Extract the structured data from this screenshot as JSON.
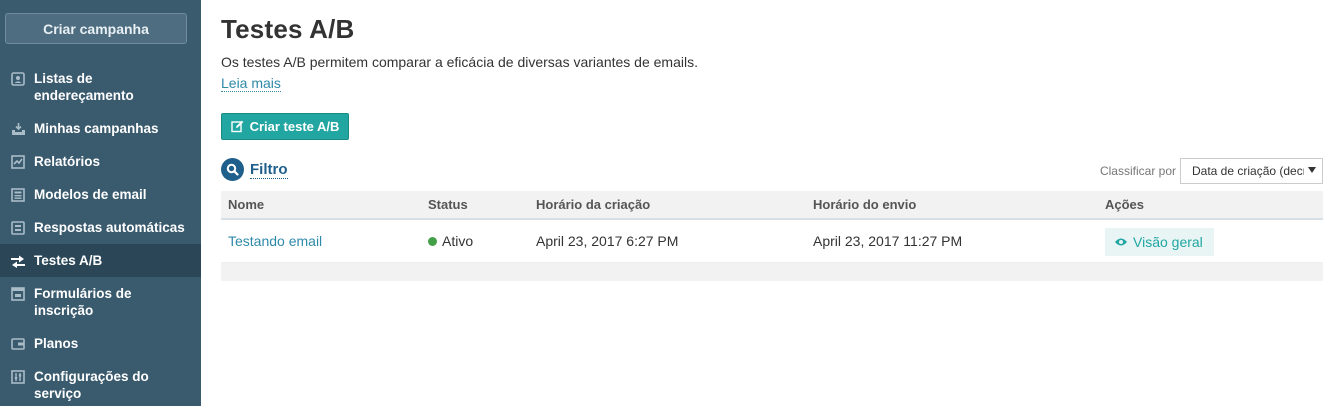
{
  "sidebar": {
    "create_campaign": "Criar campanha",
    "items": [
      {
        "label": "Listas de endereçamento",
        "icon": "address-book-icon",
        "active": false
      },
      {
        "label": "Minhas campanhas",
        "icon": "campaigns-icon",
        "active": false
      },
      {
        "label": "Relatórios",
        "icon": "chart-icon",
        "active": false
      },
      {
        "label": "Modelos de email",
        "icon": "templates-icon",
        "active": false
      },
      {
        "label": "Respostas automáticas",
        "icon": "autoresponder-icon",
        "active": false
      },
      {
        "label": "Testes A/B",
        "icon": "ab-test-icon",
        "active": true
      },
      {
        "label": "Formulários de inscrição",
        "icon": "form-icon",
        "active": false
      },
      {
        "label": "Planos",
        "icon": "wallet-icon",
        "active": false
      },
      {
        "label": "Configurações do serviço",
        "icon": "settings-sliders-icon",
        "active": false
      }
    ]
  },
  "main": {
    "title": "Testes A/B",
    "description": "Os testes A/B permitem comparar a eficácia de diversas variantes de emails.",
    "read_more": "Leia mais",
    "create_button": "Criar teste A/B",
    "filter_label": "Filtro",
    "sort": {
      "label": "Classificar por",
      "selected": "Data de criação (decr"
    },
    "table": {
      "headers": [
        "Nome",
        "Status",
        "Horário da criação",
        "Horário do envio",
        "Ações"
      ],
      "rows": [
        {
          "name": "Testando email",
          "status": "Ativo",
          "created": "April 23, 2017 6:27 PM",
          "sent": "April 23, 2017 11:27 PM",
          "action": "Visão geral"
        }
      ]
    }
  },
  "colors": {
    "sidebar_bg": "#3a5a6e",
    "sidebar_active": "#2a4657",
    "accent_teal": "#21a6a2",
    "link_blue": "#2f8aa8",
    "filter_blue": "#1f5f8b",
    "status_green": "#43a047"
  }
}
